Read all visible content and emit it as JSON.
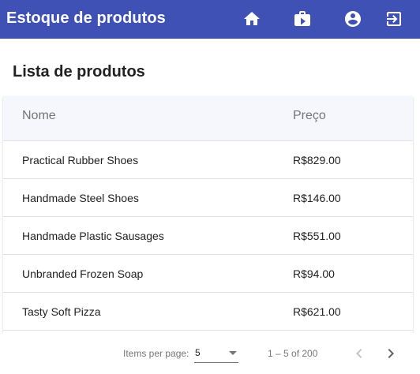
{
  "toolbar": {
    "title": "Estoque de produtos",
    "actions": [
      {
        "name": "home-icon"
      },
      {
        "name": "products-icon"
      },
      {
        "name": "account-icon"
      },
      {
        "name": "logout-icon"
      }
    ],
    "color": "#3f51b5"
  },
  "page": {
    "title": "Lista de produtos"
  },
  "table": {
    "headers": {
      "name": "Nome",
      "price": "Preço"
    },
    "rows": [
      {
        "name": "Practical Rubber Shoes",
        "price": "R$829.00"
      },
      {
        "name": "Handmade Steel Shoes",
        "price": "R$146.00"
      },
      {
        "name": "Handmade Plastic Sausages",
        "price": "R$551.00"
      },
      {
        "name": "Unbranded Frozen Soap",
        "price": "R$94.00"
      },
      {
        "name": "Tasty Soft Pizza",
        "price": "R$621.00"
      }
    ]
  },
  "paginator": {
    "items_per_page_label": "Items per page:",
    "page_size": "5",
    "range_label": "1 – 5 of 200",
    "prev_icon": "chevron-left-icon",
    "next_icon": "chevron-right-icon"
  }
}
